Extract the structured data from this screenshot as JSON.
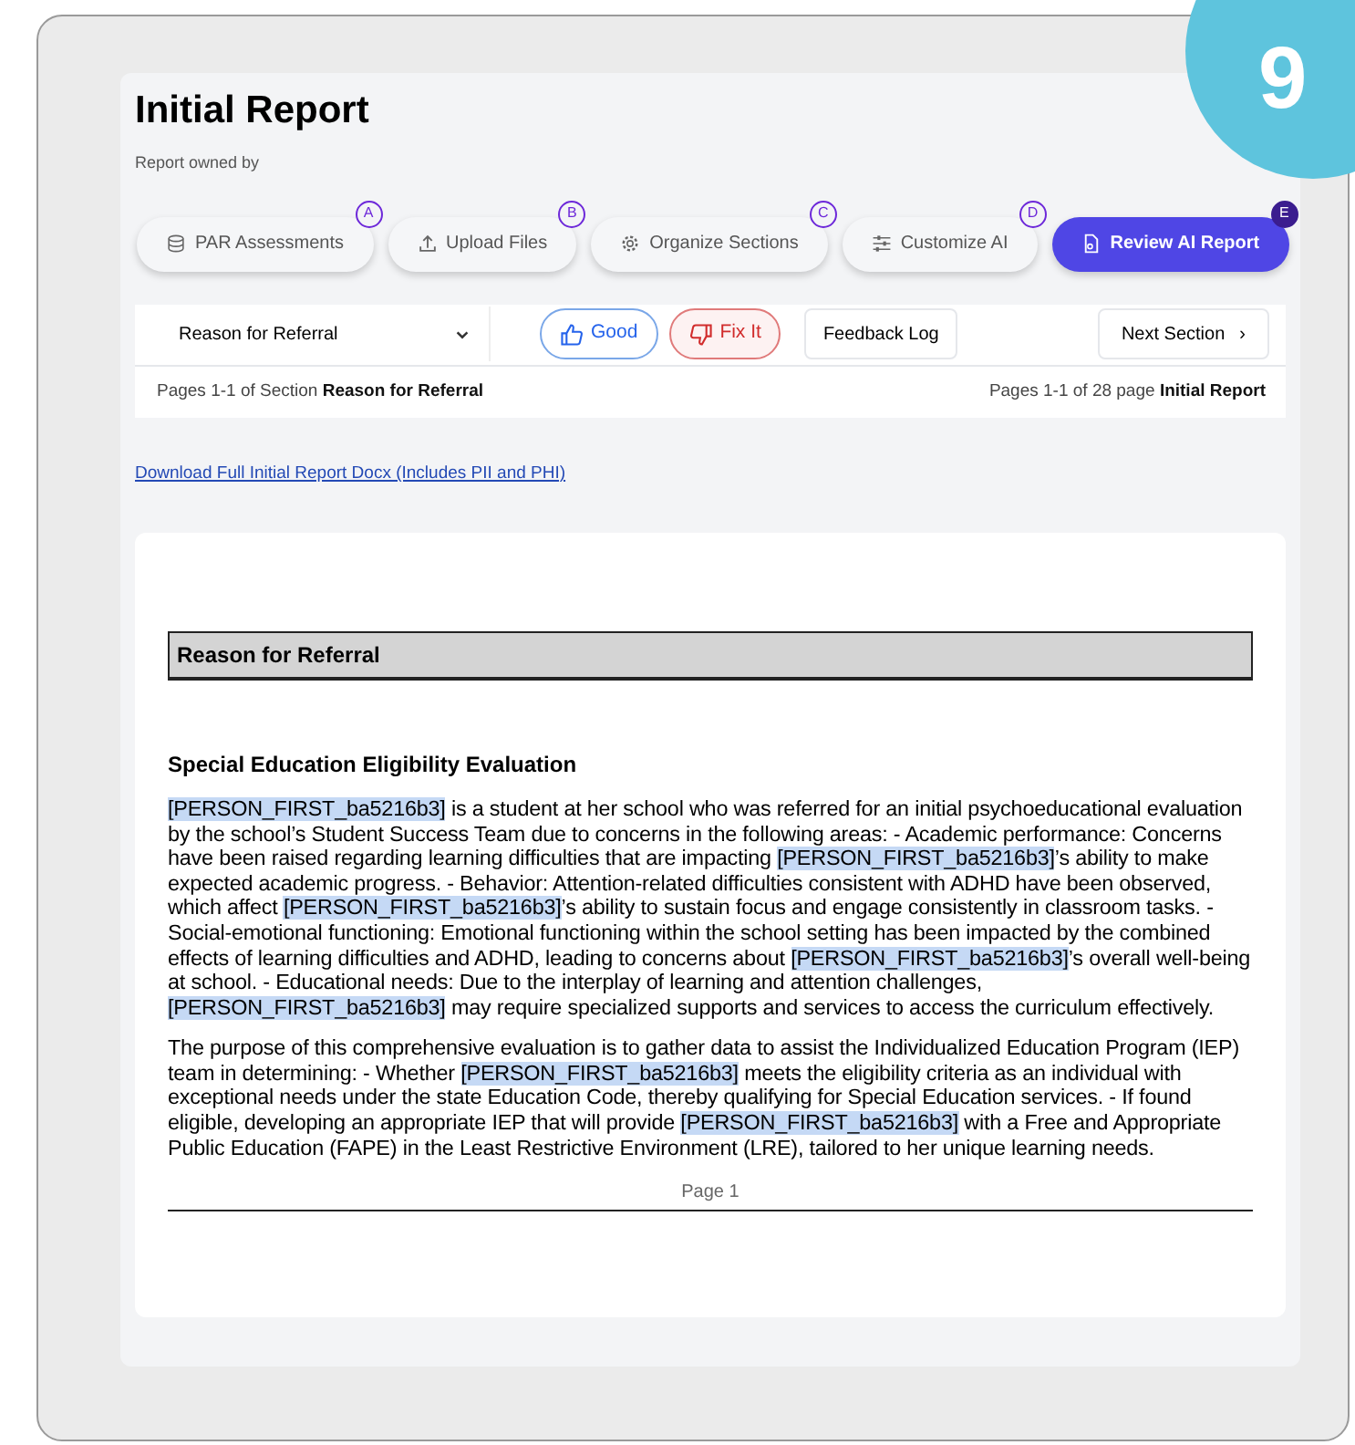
{
  "step_badge": "9",
  "header": {
    "title": "Initial Report",
    "owner_label": "Report owned by"
  },
  "steps": [
    {
      "label": "PAR Assessments",
      "letter": "A",
      "selected": false
    },
    {
      "label": "Upload Files",
      "letter": "B",
      "selected": false
    },
    {
      "label": "Organize Sections",
      "letter": "C",
      "selected": false
    },
    {
      "label": "Customize AI",
      "letter": "D",
      "selected": false
    },
    {
      "label": "Review AI Report",
      "letter": "E",
      "selected": true
    }
  ],
  "toolbar": {
    "section_select": "Reason for Referral",
    "good": "Good",
    "fix": "Fix It",
    "feedback": "Feedback Log",
    "next": "Next Section",
    "next_icon": "›"
  },
  "pagination": {
    "left": "Pages 1-1 of Section **Reason for Referral**",
    "right": "Pages 1-1 of 28 page **Initial Report**"
  },
  "download_link": "Download Full Initial Report Docx (Includes PII and PHI)",
  "document": {
    "section_title": "Reason for Referral",
    "heading": "Special Education Eligibility Evaluation",
    "paragraphs": [
      [
        {
          "text": "[PERSON_FIRST_ba5216b3]",
          "highlighted": true
        },
        {
          "text": " is a student at her school who was referred for an initial psychoeducational evaluation by the school’s Student Success Team due to concerns in the following areas: - Academic performance: Concerns have been raised regarding learning difficulties that are impacting ",
          "highlighted": false
        },
        {
          "text": "[PERSON_FIRST_ba5216b3]",
          "highlighted": true
        },
        {
          "text": "’s ability to make expected academic progress. - Behavior: Attention-related difficulties consistent with ADHD have been observed, which affect ",
          "highlighted": false
        },
        {
          "text": "[PERSON_FIRST_ba5216b3]",
          "highlighted": true
        },
        {
          "text": "’s ability to sustain focus and engage consistently in classroom tasks. - Social-emotional functioning: Emotional functioning within the school setting has been impacted by the combined effects of learning difficulties and ADHD, leading to concerns about ",
          "highlighted": false
        },
        {
          "text": "[PERSON_FIRST_ba5216b3]",
          "highlighted": true
        },
        {
          "text": "’s overall well-being at school. - Educational needs: Due to the interplay of learning and attention challenges, ",
          "highlighted": false
        },
        {
          "text": "[PERSON_FIRST_ba5216b3]",
          "highlighted": true
        },
        {
          "text": " may require specialized supports and services to access the curriculum effectively.",
          "highlighted": false
        }
      ],
      [
        {
          "text": "The purpose of this comprehensive evaluation is to gather data to assist the Individualized Education Program (IEP) team in determining: - Whether ",
          "highlighted": false
        },
        {
          "text": "[PERSON_FIRST_ba5216b3]",
          "highlighted": true
        },
        {
          "text": " meets the eligibility criteria as an individual with exceptional needs under the state Education Code, thereby qualifying for Special Education services. - If found eligible, developing an appropriate IEP that will provide ",
          "highlighted": false
        },
        {
          "text": "[PERSON_FIRST_ba5216b3]",
          "highlighted": true
        },
        {
          "text": " with a Free and Appropriate Public Education (FAPE) in the Least Restrictive Environment (LRE), tailored to her unique learning needs.",
          "highlighted": false
        }
      ]
    ],
    "footer": "Page 1"
  }
}
